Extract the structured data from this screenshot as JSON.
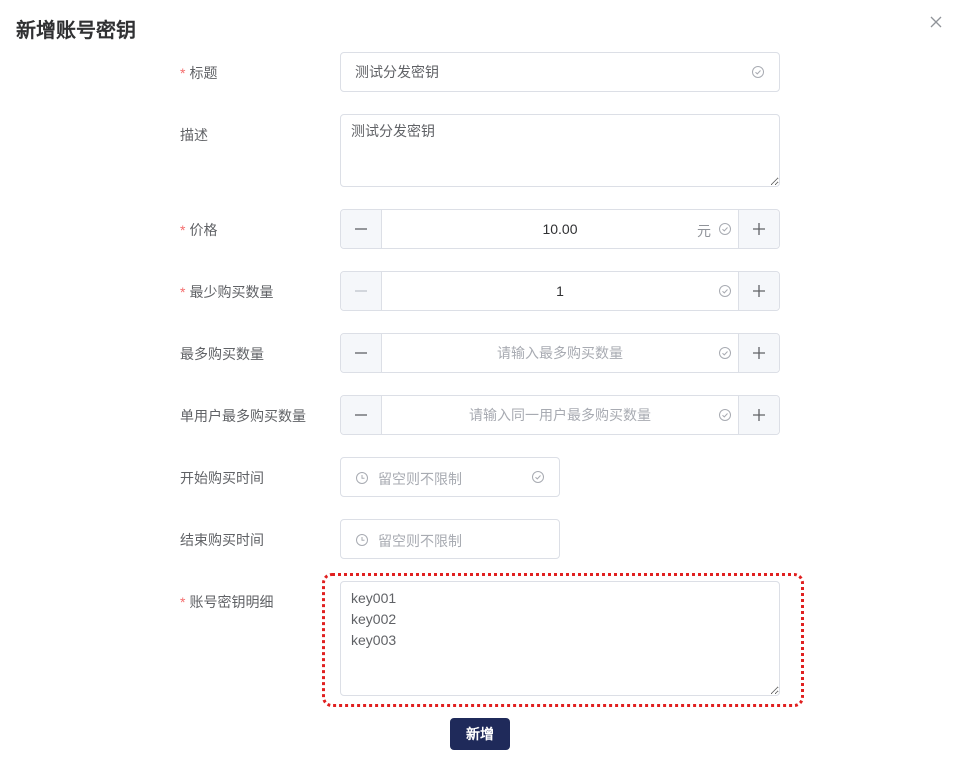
{
  "dialog": {
    "title": "新增账号密钥"
  },
  "form": {
    "title": {
      "label": "标题",
      "required": true,
      "value": "测试分发密钥"
    },
    "description": {
      "label": "描述",
      "value": "测试分发密钥"
    },
    "price": {
      "label": "价格",
      "required": true,
      "value": "10.00",
      "unit": "元"
    },
    "min_quantity": {
      "label": "最少购买数量",
      "required": true,
      "value": "1"
    },
    "max_quantity": {
      "label": "最多购买数量",
      "placeholder": "请输入最多购买数量"
    },
    "per_user_max": {
      "label": "单用户最多购买数量",
      "placeholder": "请输入同一用户最多购买数量"
    },
    "start_time": {
      "label": "开始购买时间",
      "placeholder": "留空则不限制"
    },
    "end_time": {
      "label": "结束购买时间",
      "placeholder": "留空则不限制"
    },
    "keys_detail": {
      "label": "账号密钥明细",
      "required": true,
      "value": "key001\nkey002\nkey003"
    }
  },
  "actions": {
    "submit_label": "新增"
  },
  "colors": {
    "required_star": "#f56c6c",
    "primary": "#1f2a5a",
    "highlight": "#e02020"
  }
}
